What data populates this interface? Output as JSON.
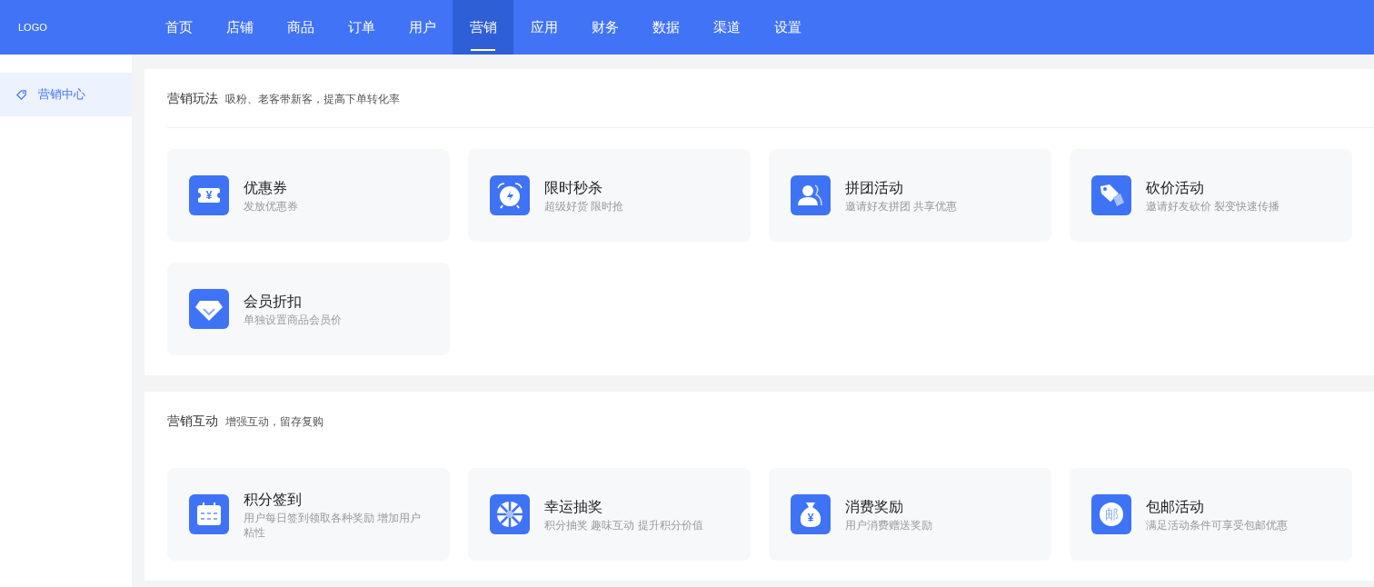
{
  "logo": "LOGO",
  "nav": [
    {
      "label": "首页",
      "selected": false
    },
    {
      "label": "店铺",
      "selected": false
    },
    {
      "label": "商品",
      "selected": false
    },
    {
      "label": "订单",
      "selected": false
    },
    {
      "label": "用户",
      "selected": false
    },
    {
      "label": "营销",
      "selected": true
    },
    {
      "label": "应用",
      "selected": false
    },
    {
      "label": "财务",
      "selected": false
    },
    {
      "label": "数据",
      "selected": false
    },
    {
      "label": "渠道",
      "selected": false
    },
    {
      "label": "设置",
      "selected": false
    }
  ],
  "sidebar": {
    "items": [
      {
        "label": "营销中心",
        "selected": true
      }
    ]
  },
  "sections": [
    {
      "title": "营销玩法",
      "subtitle": "吸粉、老客带新客，提高下单转化率",
      "divider": true,
      "cards": [
        {
          "kind": "coupon",
          "glyph": "¥",
          "title": "优惠券",
          "desc": "发放优惠券"
        },
        {
          "kind": "alarm",
          "title": "限时秒杀",
          "desc": "超级好货 限时抢"
        },
        {
          "kind": "group",
          "title": "拼团活动",
          "desc": "邀请好友拼团 共享优惠"
        },
        {
          "kind": "tag",
          "title": "砍价活动",
          "desc": "邀请好友砍价 裂变快速传播"
        },
        {
          "kind": "diamond",
          "title": "会员折扣",
          "desc": "单独设置商品会员价"
        }
      ]
    },
    {
      "title": "营销互动",
      "subtitle": "增强互动，留存复购",
      "divider": false,
      "cards": [
        {
          "kind": "calendar",
          "title": "积分签到",
          "desc": "用户每日签到领取各种奖励 增加用户粘性"
        },
        {
          "kind": "wheel",
          "title": "幸运抽奖",
          "desc": "积分抽奖 趣味互动 提升积分价值"
        },
        {
          "kind": "bag",
          "glyph": "¥",
          "title": "消费奖励",
          "desc": "用户消费赠送奖励"
        },
        {
          "kind": "stamp",
          "glyph": "邮",
          "title": "包邮活动",
          "desc": "满足活动条件可享受包邮优惠"
        }
      ]
    }
  ]
}
